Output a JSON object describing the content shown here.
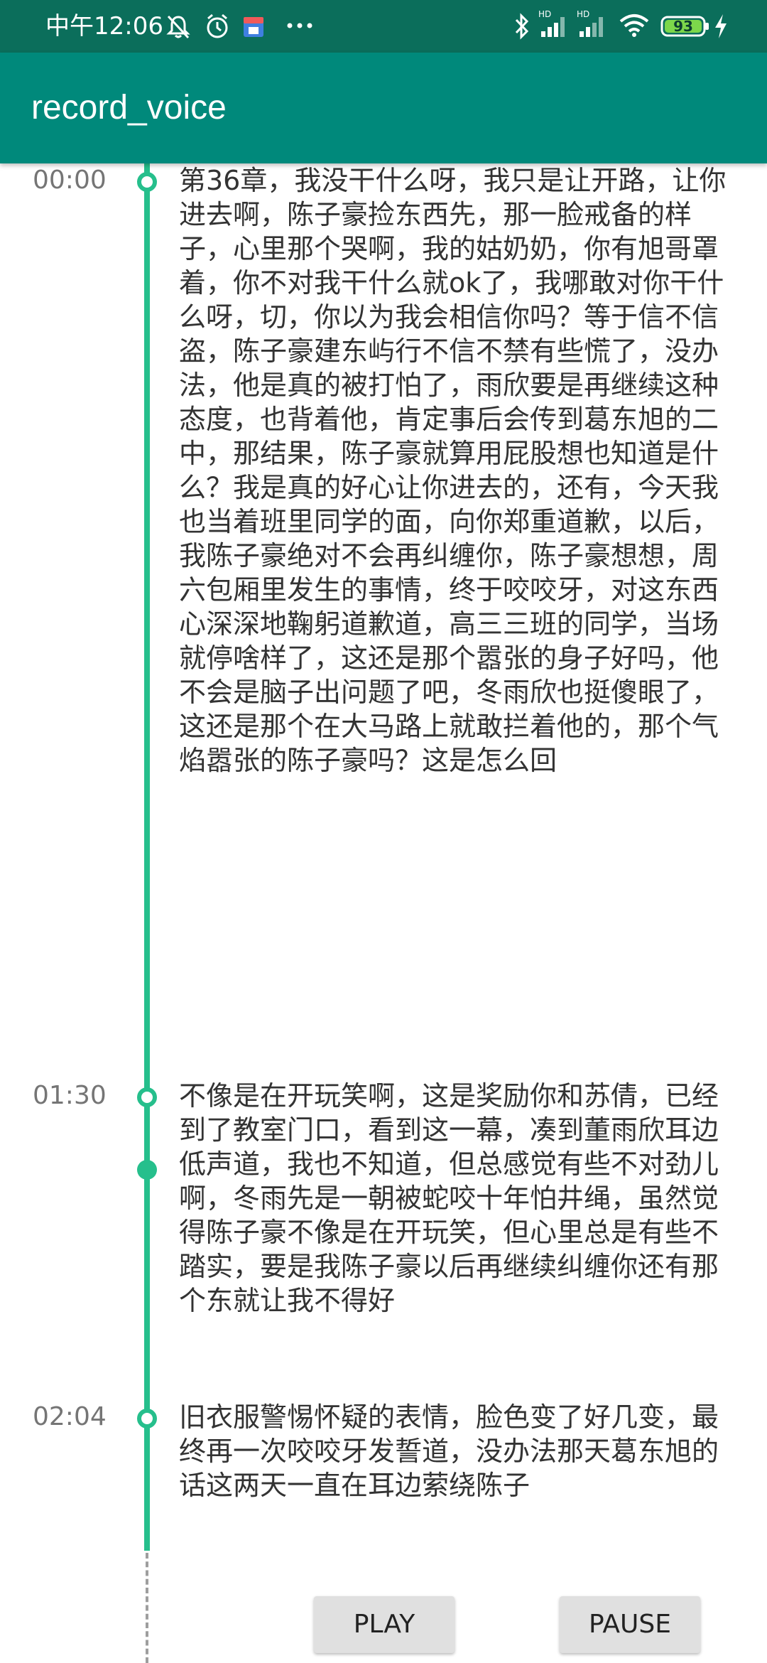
{
  "status_bar": {
    "time": "中午12:06",
    "battery": "93",
    "network_labels": [
      "HD",
      "HD"
    ],
    "icons": [
      "mute-icon",
      "alarm-icon",
      "store-icon",
      "more-dots-icon",
      "bluetooth-icon",
      "signal-icon",
      "signal-icon",
      "wifi-icon",
      "battery-icon",
      "charging-icon"
    ]
  },
  "app_bar": {
    "title": "record_voice"
  },
  "timeline": {
    "entries": [
      {
        "time": "00:00",
        "text": "第36章，我没干什么呀，我只是让开路，让你进去啊，陈子豪捡东西先，那一脸戒备的样子，心里那个哭啊，我的姑奶奶，你有旭哥罩着，你不对我干什么就ok了，我哪敢对你干什么呀，切，你以为我会相信你吗？等于信不信盗，陈子豪建东屿行不信不禁有些慌了，没办法，他是真的被打怕了，雨欣要是再继续这种态度，也背着他，肯定事后会传到葛东旭的二中，那结果，陈子豪就算用屁股想也知道是什么？我是真的好心让你进去的，还有，今天我也当着班里同学的面，向你郑重道歉，以后，我陈子豪绝对不会再纠缠你，陈子豪想想，周六包厢里发生的事情，终于咬咬牙，对这东西心深深地鞠躬道歉道，高三三班的同学，当场就停啥样了，这还是那个嚣张的身子好吗，他不会是脑子出问题了吧，冬雨欣也挺傻眼了，这还是那个在大马路上就敢拦着他的，那个气焰嚣张的陈子豪吗？这是怎么回"
      },
      {
        "time": "01:30",
        "text": "不像是在开玩笑啊，这是奖励你和苏倩，已经到了教室门口，看到这一幕，凑到董雨欣耳边低声道，我也不知道，但总感觉有些不对劲儿啊，冬雨先是一朝被蛇咬十年怕井绳，虽然觉得陈子豪不像是在开玩笑，但心里总是有些不踏实，要是我陈子豪以后再继续纠缠你还有那个东就让我不得好"
      },
      {
        "time": "02:04",
        "text": "旧衣服警惕怀疑的表情，脸色变了好几变，最终再一次咬咬牙发誓道，没办法那天葛东旭的话这两天一直在耳边萦绕陈子"
      }
    ]
  },
  "controls": {
    "play_label": "PLAY",
    "pause_label": "PAUSE"
  },
  "colors": {
    "status_bar": "#0b6e5b",
    "app_bar": "#00897b",
    "timeline_accent": "#26bf8c",
    "button_bg": "#e0e0e0"
  }
}
